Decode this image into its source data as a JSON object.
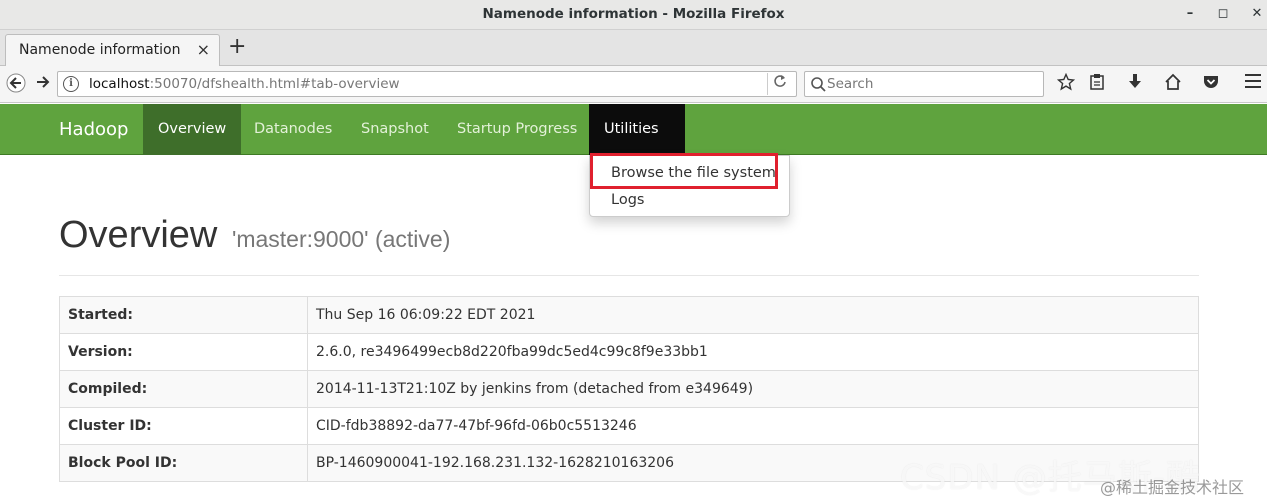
{
  "window": {
    "title": "Namenode information - Mozilla Firefox",
    "minimize": "–",
    "maximize": "◻",
    "close": "✕"
  },
  "browser": {
    "tab_label": "Namenode information",
    "tab_close": "×",
    "new_tab": "+",
    "url_host": "localhost",
    "url_rest": ":50070/dfshealth.html#tab-overview",
    "search_placeholder": "Search"
  },
  "hadoop_nav": {
    "brand": "Hadoop",
    "items": [
      "Overview",
      "Datanodes",
      "Snapshot",
      "Startup Progress",
      "Utilities"
    ],
    "active": "Overview",
    "dropdown_items": [
      "Browse the file system",
      "Logs"
    ],
    "colors": {
      "navbar": "#5fa33e",
      "active": "#3e6e2a",
      "open": "#0c0c0c",
      "highlight_box": "#e0202e"
    }
  },
  "overview": {
    "heading": "Overview",
    "subheading": "'master:9000' (active)",
    "rows": [
      {
        "label": "Started:",
        "value": "Thu Sep 16 06:09:22 EDT 2021"
      },
      {
        "label": "Version:",
        "value": "2.6.0, re3496499ecb8d220fba99dc5ed4c99c8f9e33bb1"
      },
      {
        "label": "Compiled:",
        "value": "2014-11-13T21:10Z by jenkins from (detached from e349649)"
      },
      {
        "label": "Cluster ID:",
        "value": "CID-fdb38892-da77-47bf-96fd-06b0c5513246"
      },
      {
        "label": "Block Pool ID:",
        "value": "BP-1460900041-192.168.231.132-1628210163206"
      }
    ]
  },
  "watermark": {
    "line1": "CSDN @托马斯-酷",
    "line2": "@稀土掘金技术社区"
  }
}
